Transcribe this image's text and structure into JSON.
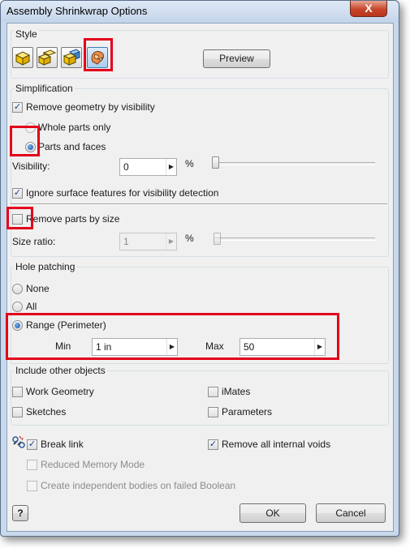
{
  "window": {
    "title": "Assembly Shrinkwrap Options",
    "close_glyph": "X"
  },
  "style": {
    "group_label": "Style",
    "icons": [
      "remove-none-style-icon",
      "single-solid-merged-style-icon",
      "single-solid-no-seams-style-icon",
      "multiple-solid-style-icon"
    ],
    "preview_label": "Preview"
  },
  "simplification": {
    "group_label": "Simplification",
    "remove_by_visibility": {
      "label": "Remove geometry by visibility",
      "checked": true
    },
    "whole_parts_only": {
      "label": "Whole parts only",
      "selected": false
    },
    "parts_and_faces": {
      "label": "Parts and faces",
      "selected": true
    },
    "visibility": {
      "label": "Visibility:",
      "value": "0",
      "unit": "%"
    },
    "ignore_surface": {
      "label": "Ignore surface features for visibility detection",
      "checked": true
    },
    "remove_by_size": {
      "label": "Remove parts by size",
      "checked": false
    },
    "size_ratio": {
      "label": "Size ratio:",
      "value": "1",
      "unit": "%"
    }
  },
  "hole_patching": {
    "group_label": "Hole patching",
    "none_label": "None",
    "all_label": "All",
    "range_label": "Range (Perimeter)",
    "selected": "range",
    "min_label": "Min",
    "min_value": "1 in",
    "max_label": "Max",
    "max_value": "50"
  },
  "include_other": {
    "group_label": "Include other objects",
    "work_geometry": {
      "label": "Work Geometry",
      "checked": false
    },
    "imates": {
      "label": "iMates",
      "checked": false
    },
    "sketches": {
      "label": "Sketches",
      "checked": false
    },
    "parameters": {
      "label": "Parameters",
      "checked": false
    }
  },
  "options": {
    "break_link": {
      "label": "Break link",
      "checked": true
    },
    "remove_voids": {
      "label": "Remove all internal voids",
      "checked": true
    },
    "reduced_memory": {
      "label": "Reduced Memory Mode",
      "checked": false
    },
    "independent_bodies": {
      "label": "Create independent bodies on failed Boolean",
      "checked": false
    }
  },
  "footer": {
    "help_glyph": "?",
    "ok_label": "OK",
    "cancel_label": "Cancel"
  },
  "colors": {
    "highlight": "#e3001b",
    "title_bg": "#c4d5ea",
    "client_bg": "#f0f0f0"
  }
}
